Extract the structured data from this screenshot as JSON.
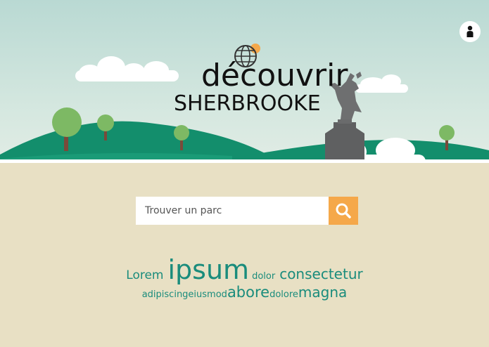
{
  "header": {
    "title_main": "découvrir",
    "title_sub": "SHERBROOKE",
    "icons": {
      "logo": "globe-icon",
      "user": "user-icon"
    }
  },
  "search": {
    "placeholder": "Trouver un parc",
    "value": "",
    "button_icon": "search-icon"
  },
  "tags": {
    "line1": [
      "Lorem",
      "ipsum",
      "dolor",
      "consectetur"
    ],
    "line2": [
      "adipiscingeiusmod",
      "abore",
      "dolore",
      "magna"
    ]
  },
  "colors": {
    "sky": "#b9d9d3",
    "hill_dark": "#138e6c",
    "hill_light": "#2b9a6d",
    "ground": "#e8e0c4",
    "accent": "#f5a84a",
    "tag": "#1a8c7c"
  }
}
